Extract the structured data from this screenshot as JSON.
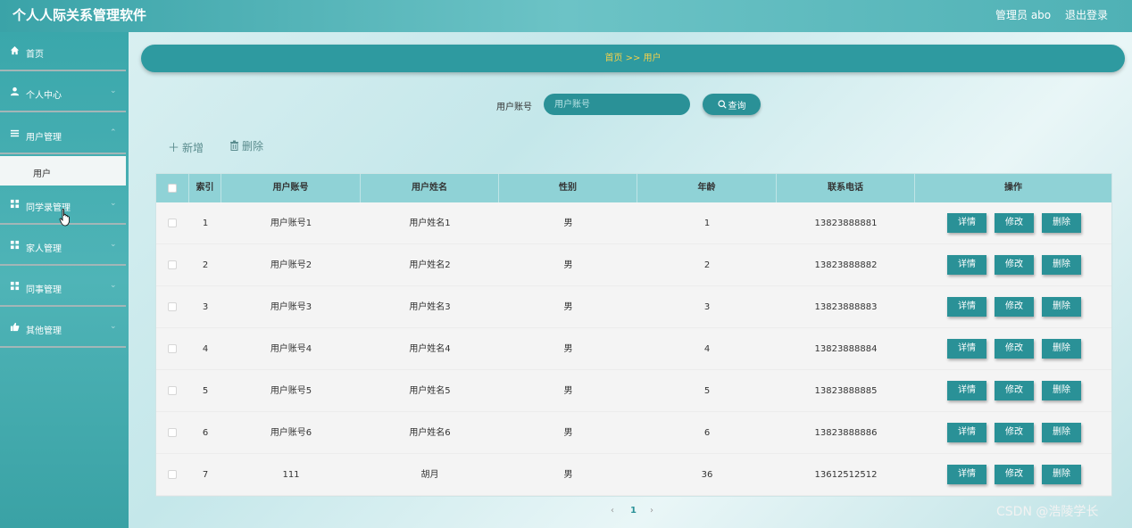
{
  "app": {
    "title": "个人人际关系管理软件",
    "admin": "管理员 abo",
    "logout": "退出登录"
  },
  "sidebar": {
    "items": [
      {
        "label": "首页",
        "icon": "home-icon"
      },
      {
        "label": "个人中心",
        "icon": "user-icon"
      },
      {
        "label": "用户管理",
        "icon": "list-icon"
      },
      {
        "label": "同学录管理",
        "icon": "grid-icon"
      },
      {
        "label": "家人管理",
        "icon": "grid-icon"
      },
      {
        "label": "同事管理",
        "icon": "grid-icon"
      },
      {
        "label": "其他管理",
        "icon": "thumb-icon"
      }
    ],
    "submenu": {
      "label": "用户"
    }
  },
  "breadcrumb": {
    "text": "首页 >> 用户"
  },
  "search": {
    "label": "用户账号",
    "placeholder": "用户账号",
    "button": "查询"
  },
  "actions": {
    "add": "新增",
    "delete": "删除"
  },
  "table": {
    "headers": [
      "索引",
      "用户账号",
      "用户姓名",
      "性别",
      "年龄",
      "联系电话",
      "操作"
    ],
    "rows": [
      {
        "index": "1",
        "account": "用户账号1",
        "name": "用户姓名1",
        "gender": "男",
        "age": "1",
        "phone": "13823888881"
      },
      {
        "index": "2",
        "account": "用户账号2",
        "name": "用户姓名2",
        "gender": "男",
        "age": "2",
        "phone": "13823888882"
      },
      {
        "index": "3",
        "account": "用户账号3",
        "name": "用户姓名3",
        "gender": "男",
        "age": "3",
        "phone": "13823888883"
      },
      {
        "index": "4",
        "account": "用户账号4",
        "name": "用户姓名4",
        "gender": "男",
        "age": "4",
        "phone": "13823888884"
      },
      {
        "index": "5",
        "account": "用户账号5",
        "name": "用户姓名5",
        "gender": "男",
        "age": "5",
        "phone": "13823888885"
      },
      {
        "index": "6",
        "account": "用户账号6",
        "name": "用户姓名6",
        "gender": "男",
        "age": "6",
        "phone": "13823888886"
      },
      {
        "index": "7",
        "account": "111",
        "name": "胡月",
        "gender": "男",
        "age": "36",
        "phone": "13612512512"
      }
    ],
    "row_buttons": {
      "detail": "详情",
      "edit": "修改",
      "delete": "删除"
    }
  },
  "pagination": {
    "prev": "‹",
    "current": "1",
    "next": "›"
  },
  "watermark": "CSDN @浩陵学长",
  "colors": {
    "accent": "#2a9197",
    "header_bg": "#8fd2d6",
    "breadcrumb_text": "#f3d04b",
    "sidebar": "#3aa7ab"
  }
}
